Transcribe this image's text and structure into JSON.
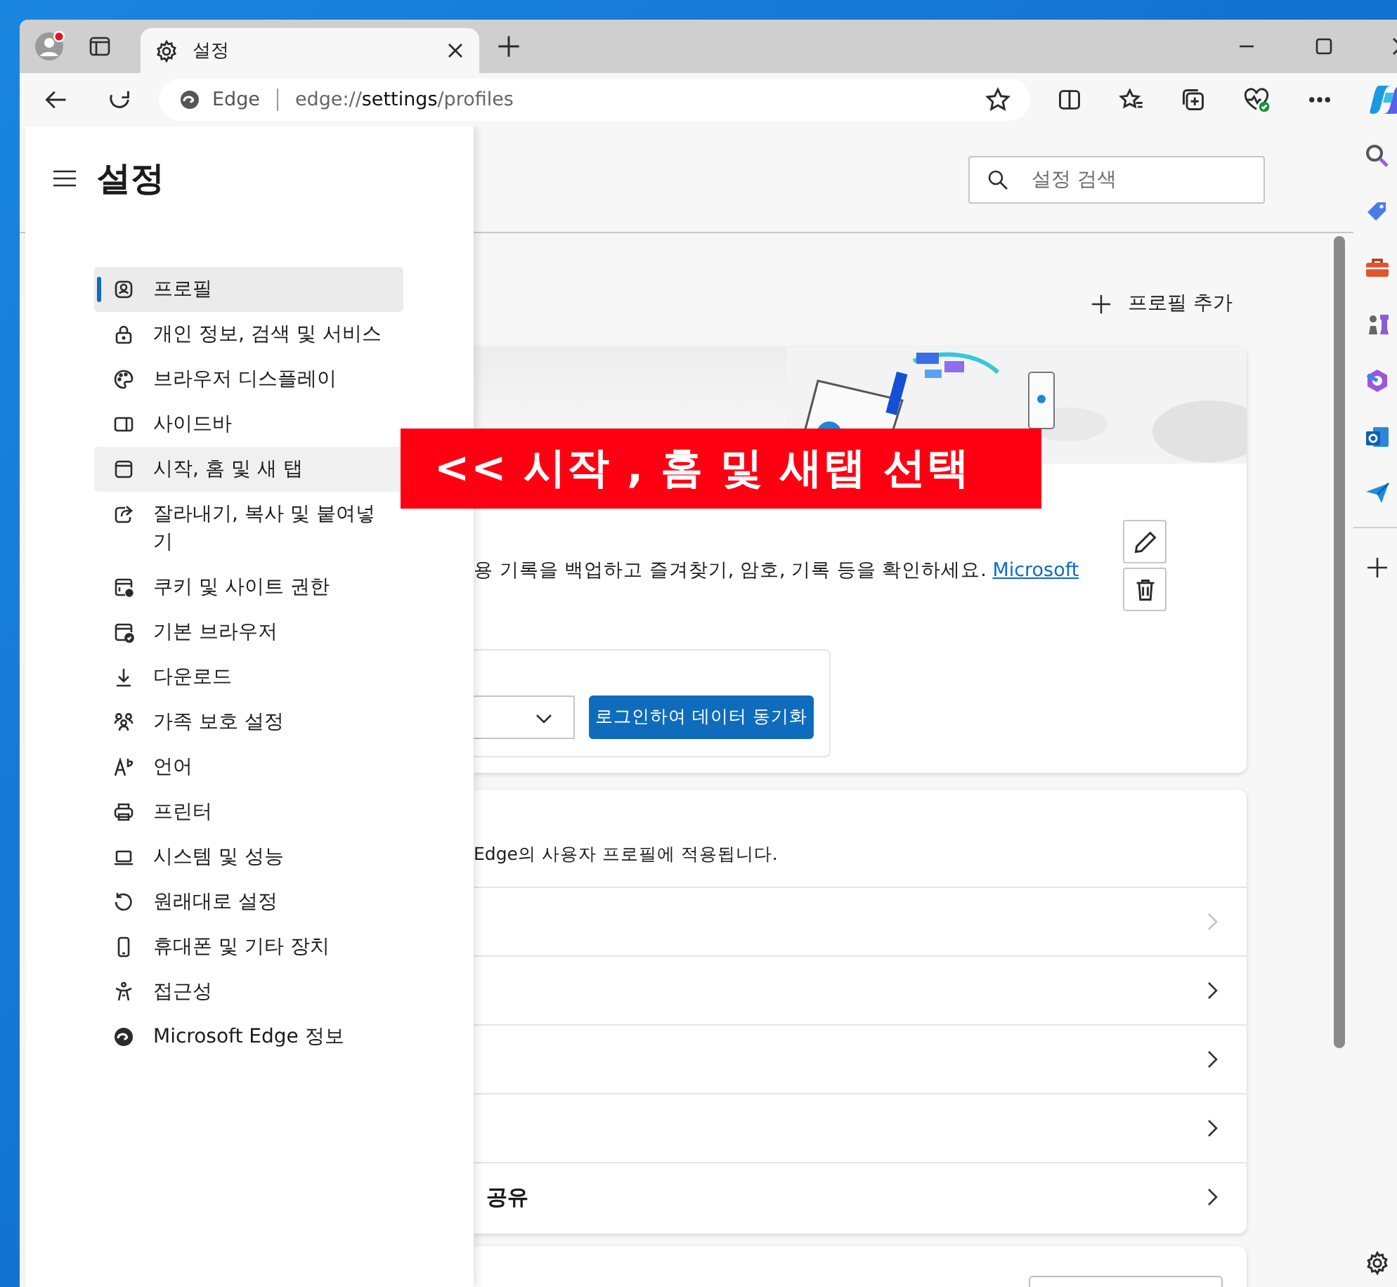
{
  "window": {
    "tab": {
      "title": "설정"
    },
    "address": {
      "site_label": "Edge",
      "url": "edge://**settings**/profiles"
    }
  },
  "sidebar": {
    "title": "설정",
    "items": [
      {
        "label": "프로필",
        "selected": true,
        "hovered": false
      },
      {
        "label": "개인 정보, 검색 및 서비스",
        "selected": false,
        "hovered": false
      },
      {
        "label": "브라우저 디스플레이",
        "selected": false,
        "hovered": false
      },
      {
        "label": "사이드바",
        "selected": false,
        "hovered": false
      },
      {
        "label": "시작, 홈 및 새 탭",
        "selected": false,
        "hovered": true
      },
      {
        "label": "잘라내기, 복사 및 붙여넣기",
        "selected": false,
        "hovered": false
      },
      {
        "label": "쿠키 및 사이트 권한",
        "selected": false,
        "hovered": false
      },
      {
        "label": "기본 브라우저",
        "selected": false,
        "hovered": false
      },
      {
        "label": "다운로드",
        "selected": false,
        "hovered": false
      },
      {
        "label": "가족 보호 설정",
        "selected": false,
        "hovered": false
      },
      {
        "label": "언어",
        "selected": false,
        "hovered": false
      },
      {
        "label": "프린터",
        "selected": false,
        "hovered": false
      },
      {
        "label": "시스템 및 성능",
        "selected": false,
        "hovered": false
      },
      {
        "label": "원래대로 설정",
        "selected": false,
        "hovered": false
      },
      {
        "label": "휴대폰 및 기타 장치",
        "selected": false,
        "hovered": false
      },
      {
        "label": "접근성",
        "selected": false,
        "hovered": false
      },
      {
        "label": "Microsoft Edge 정보",
        "selected": false,
        "hovered": false
      }
    ]
  },
  "search": {
    "placeholder": "설정 검색"
  },
  "profile_card": {
    "add_label": "프로필 추가",
    "description": "용 기록을 백업하고 즐겨찾기, 암호, 기록 등을 확인하세요.",
    "link": "Microsoft",
    "sync_button": "로그인하여 데이터 동기화"
  },
  "settings_card": {
    "description": "Edge의 사용자 프로필에 적용됩니다.",
    "rows": [
      {
        "disabled": true
      },
      {
        "disabled": false
      },
      {
        "disabled": false
      },
      {
        "disabled": false
      },
      {
        "label": "공유",
        "disabled": false
      }
    ]
  },
  "annotation": {
    "text": "<< 시작 , 홈 및 새탭 선택"
  }
}
